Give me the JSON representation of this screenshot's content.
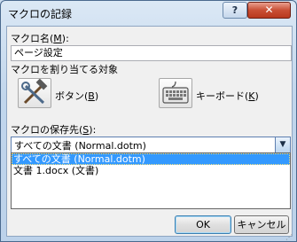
{
  "window": {
    "title": "マクロの記録",
    "help_label": "?",
    "close_label": "✕"
  },
  "macro_name": {
    "label": "マクロ名(",
    "mnemonic": "M",
    "label_end": "):",
    "value": "ページ設定"
  },
  "assign_section": {
    "label": "マクロを割り当てる対象"
  },
  "button_option": {
    "label": "ボタン(",
    "mnemonic": "B",
    "label_end": ")",
    "icon": "hammer-wrench-icon"
  },
  "keyboard_option": {
    "label": "キーボード(",
    "mnemonic": "K",
    "label_end": ")",
    "icon": "keyboard-icon"
  },
  "store_in": {
    "label": "マクロの保存先(",
    "mnemonic": "S",
    "label_end": "):",
    "selected": "すべての文書 (Normal.dotm)",
    "options": [
      "すべての文書 (Normal.dotm)",
      "文書 1.docx (文書)"
    ]
  },
  "buttons": {
    "ok": "OK",
    "cancel": "キャンセル"
  },
  "colors": {
    "selection": "#3399ff",
    "window_frame": "#c1d6ec",
    "close_button": "#c94f34"
  }
}
